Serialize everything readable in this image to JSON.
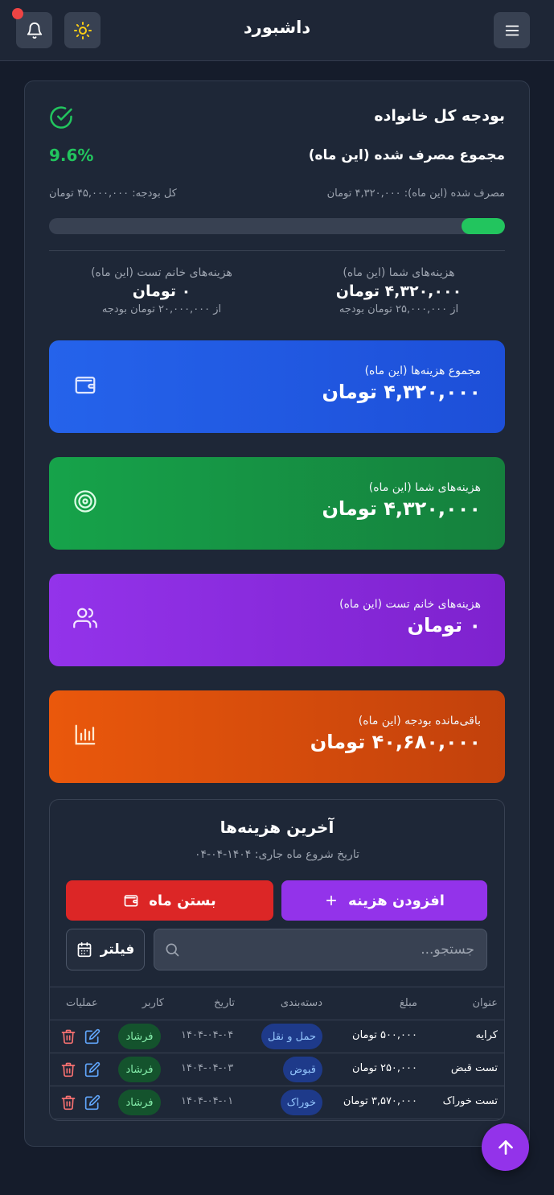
{
  "header": {
    "title": "داشبورد",
    "menu_icon": "menu-icon",
    "theme_icon": "sun-icon",
    "notification_icon": "bell-icon"
  },
  "budget": {
    "title": "بودجه کل خانواده",
    "status_icon": "check-circle-icon",
    "spent_title": "مجموع مصرف شده (این ماه)",
    "percent": "9.6%",
    "spent_text": "مصرف شده (این ماه): ۴,۳۲۰,۰۰۰ تومان",
    "total_text": "کل بودجه: ۴۵,۰۰۰,۰۰۰ تومان",
    "progress_fraction": 0.096,
    "progress_color": "#22c55e"
  },
  "members": [
    {
      "label": "هزینه‌های شما (این ماه)",
      "value": "۴,۳۲۰,۰۰۰ تومان",
      "budget_text": "از ۲۵,۰۰۰,۰۰۰ تومان بودجه"
    },
    {
      "label": "هزینه‌های خانم تست (این ماه)",
      "value": "۰ تومان",
      "budget_text": "از ۲۰,۰۰۰,۰۰۰ تومان بودجه"
    }
  ],
  "cards": [
    {
      "label": "مجموع هزینه‌ها (این ماه)",
      "value": "۴,۳۲۰,۰۰۰ تومان",
      "icon": "wallet-icon",
      "color": "#2563eb"
    },
    {
      "label": "هزینه‌های شما (این ماه)",
      "value": "۴,۳۲۰,۰۰۰ تومان",
      "icon": "target-icon",
      "color": "#16a34a"
    },
    {
      "label": "هزینه‌های خانم تست (این ماه)",
      "value": "۰ تومان",
      "icon": "users-icon",
      "color": "#9333ea"
    },
    {
      "label": "باقی‌مانده بودجه (این ماه)",
      "value": "۴۰,۶۸۰,۰۰۰ تومان",
      "icon": "bar-chart-icon",
      "color": "#ea580c"
    }
  ],
  "recent": {
    "title": "آخرین هزینه‌ها",
    "month_start": "تاریخ شروع ماه جاری: ۱۴۰۴-۰۴-۰۴",
    "add_button": "افزودن هزینه",
    "close_button": "بستن ماه",
    "search_placeholder": "جستجو...",
    "filter_button": "فیلتر",
    "columns": [
      "عنوان",
      "مبلغ",
      "دسته‌بندی",
      "تاریخ",
      "کاربر",
      "عملیات"
    ],
    "rows": [
      {
        "title": "کرایه",
        "amount": "۵۰۰,۰۰۰ تومان",
        "category": "حمل و نقل",
        "date": "۱۴۰۴-۰۴-۰۴",
        "user": "فرشاد"
      },
      {
        "title": "تست قبض",
        "amount": "۲۵۰,۰۰۰ تومان",
        "category": "قبوض",
        "date": "۱۴۰۴-۰۴-۰۳",
        "user": "فرشاد"
      },
      {
        "title": "تست خوراک",
        "amount": "۳,۵۷۰,۰۰۰ تومان",
        "category": "خوراک",
        "date": "۱۴۰۴-۰۴-۰۱",
        "user": "فرشاد"
      }
    ]
  },
  "fab_icon": "arrow-up-icon"
}
